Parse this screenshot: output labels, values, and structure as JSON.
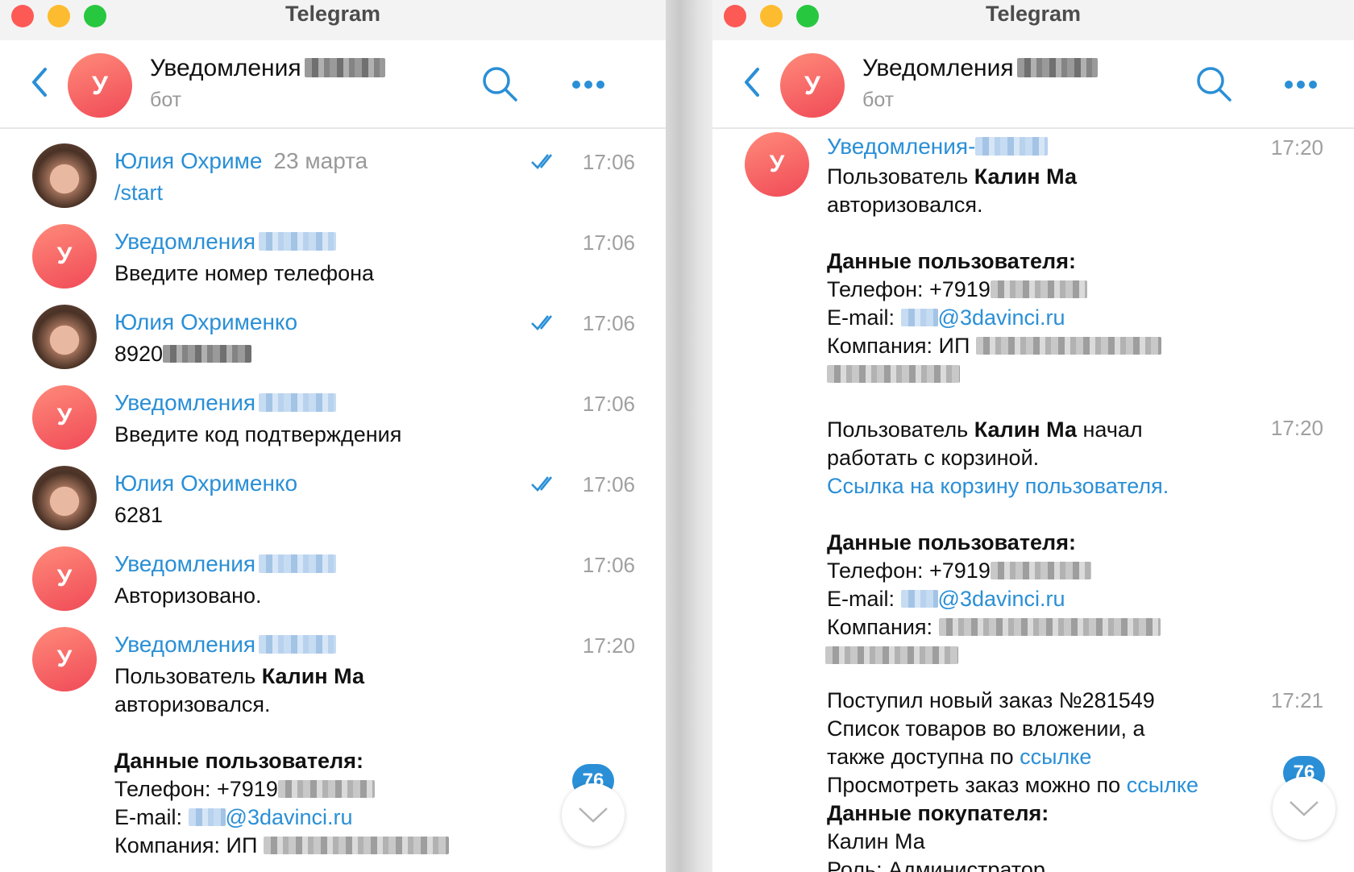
{
  "colors": {
    "accent": "#2a8fd6",
    "bot_avatar": "#f04a57",
    "meta_text": "#a0a0a0"
  },
  "left_window": {
    "title": "Telegram",
    "header": {
      "chat_name": "Уведомления",
      "subtitle": "бот",
      "avatar_letter": "У"
    },
    "messages": [
      {
        "sender": "Юлия Охриме",
        "date": "23 марта",
        "text": "/start",
        "time": "17:06",
        "read": true
      },
      {
        "sender": "Уведомления",
        "text": "Введите номер телефона",
        "time": "17:06"
      },
      {
        "sender": "Юлия Охрименко",
        "text": "8920",
        "time": "17:06",
        "read": true
      },
      {
        "sender": "Уведомления",
        "text": "Введите код подтверждения",
        "time": "17:06"
      },
      {
        "sender": "Юлия Охрименко",
        "text": "6281",
        "time": "17:06",
        "read": true
      },
      {
        "sender": "Уведомления",
        "text": "Авторизовано.",
        "time": "17:06"
      },
      {
        "sender": "Уведомления",
        "time": "17:20",
        "line1_prefix": "Пользователь",
        "user_name": "Калин  Ма",
        "line2": "авторизовался.",
        "data_heading": "Данные пользователя:",
        "phone_label": "Телефон: +7919",
        "email_label": "E-mail:",
        "email_domain": "@3davinci.ru",
        "company_label": "Компания: ИП"
      }
    ],
    "unread_count": "76"
  },
  "right_window": {
    "title": "Telegram",
    "header": {
      "chat_name": "Уведомления",
      "subtitle": "бот",
      "avatar_letter": "У"
    },
    "msg1": {
      "sender": "Уведомления-",
      "time": "17:20",
      "line1_prefix": "Пользователь",
      "user_name": "Калин  Ма",
      "line2": "авторизовался.",
      "data_heading": "Данные пользователя:",
      "phone_label": "Телефон: +7919",
      "email_label": "E-mail:",
      "email_domain": "@3davinci.ru",
      "company_label": "Компания: ИП"
    },
    "msg2": {
      "time": "17:20",
      "line1_prefix": "Пользователь",
      "user_name": "Калин  Ма",
      "line1_suffix": "начал",
      "line2": "работать с корзиной.",
      "link": "Ссылка на корзину пользователя.",
      "data_heading": "Данные пользователя:",
      "phone_label": "Телефон: +7919",
      "email_label": "E-mail:",
      "email_domain": "@3davinci.ru",
      "company_label": "Компания:"
    },
    "msg3": {
      "time": "17:21",
      "line1": "Поступил новый заказ №281549",
      "line2": "Список товаров во вложении, а",
      "line3_prefix": "также доступна по",
      "line3_link": "ссылке",
      "line4_prefix": "Просмотреть заказ можно по",
      "line4_link": "ссылке",
      "buyer_heading": "Данные покупателя:",
      "buyer_name": "Калин  Ма",
      "role": "Роль: Администратор"
    },
    "unread_count": "76"
  }
}
